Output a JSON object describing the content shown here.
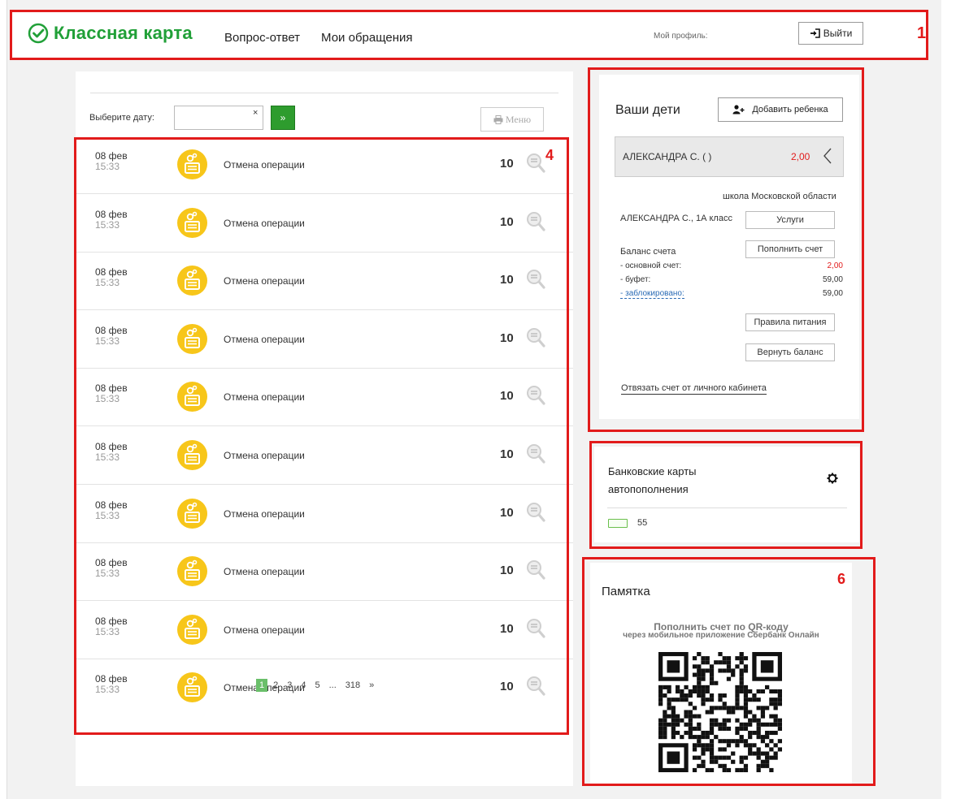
{
  "header": {
    "logo_text": "Классная карта",
    "nav": [
      "Вопрос-ответ",
      "Мои обращения"
    ],
    "profile_label": "Мой профиль:",
    "logout_label": "Выйти",
    "brand_color": "#21a038"
  },
  "annotations": [
    "1",
    "4",
    "6"
  ],
  "filter": {
    "date_label": "Выберите дату:",
    "date_value": "",
    "clear_symbol": "×",
    "go_symbol": "»",
    "menu_label": "Меню"
  },
  "operations": [
    {
      "date": "08 фев",
      "time": "15:33",
      "title": "Отмена операции",
      "amount": "10"
    },
    {
      "date": "08 фев",
      "time": "15:33",
      "title": "Отмена операции",
      "amount": "10"
    },
    {
      "date": "08 фев",
      "time": "15:33",
      "title": "Отмена операции",
      "amount": "10"
    },
    {
      "date": "08 фев",
      "time": "15:33",
      "title": "Отмена операции",
      "amount": "10"
    },
    {
      "date": "08 фев",
      "time": "15:33",
      "title": "Отмена операции",
      "amount": "10"
    },
    {
      "date": "08 фев",
      "time": "15:33",
      "title": "Отмена операции",
      "amount": "10"
    },
    {
      "date": "08 фев",
      "time": "15:33",
      "title": "Отмена операции",
      "amount": "10"
    },
    {
      "date": "08 фев",
      "time": "15:33",
      "title": "Отмена операции",
      "amount": "10"
    },
    {
      "date": "08 фев",
      "time": "15:33",
      "title": "Отмена операции",
      "amount": "10"
    },
    {
      "date": "08 фев",
      "time": "15:33",
      "title": "Отмена операции",
      "amount": "10"
    }
  ],
  "pagination": {
    "pages": [
      "1",
      "2",
      "3",
      "4",
      "5",
      "...",
      "318",
      "»"
    ],
    "active": "1"
  },
  "children": {
    "title": "Ваши дети",
    "add_label": "Добавить ребенка",
    "child_name": "АЛЕКСАНДРА С. (          )",
    "child_balance": "2,00",
    "school": "школа Московской области",
    "class_label": "АЛЕКСАНДРА С., 1А класс",
    "services_label": "Услуги",
    "balance_label": "Баланс счета",
    "topup_label": "Пополнить счет",
    "lines": [
      {
        "label": "- основной счет:",
        "value": "2,00"
      },
      {
        "label": "- буфет:",
        "value": "59,00"
      },
      {
        "label": "- заблокировано:",
        "value": "59,00"
      }
    ],
    "rules_label": "Правила питания",
    "refund_label": "Вернуть баланс",
    "unlink_label": "Отвязать счет от личного кабинета"
  },
  "cards": {
    "title": "Банковские карты автопополнения",
    "card_number": "55"
  },
  "memo": {
    "title": "Памятка",
    "subtitle1": "Пополнить счет по QR-коду",
    "subtitle2": "через мобильное приложение Сбербанк Онлайн"
  },
  "colors": {
    "annotation": "#e21b1b",
    "accent_green": "#2e9c2e",
    "negative": "#e21b1b",
    "icon_yellow": "#f7c61a"
  }
}
